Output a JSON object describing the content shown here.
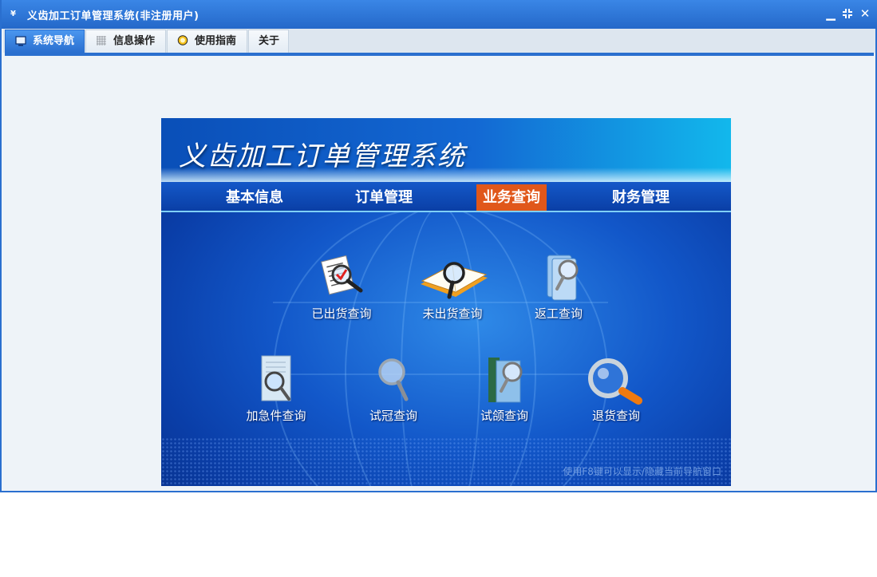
{
  "window": {
    "title": "义齿加工订单管理系统(非注册用户)",
    "app_icon": "app-logo-icon",
    "controls": {
      "minimize_icon": "minimize-icon",
      "restore_icon": "restore-icon",
      "close_icon": "close-icon"
    }
  },
  "tabs": [
    {
      "label": "系统导航",
      "icon": "monitor-icon",
      "active": true
    },
    {
      "label": "信息操作",
      "icon": "grid-icon",
      "active": false
    },
    {
      "label": "使用指南",
      "icon": "help-icon",
      "active": false
    },
    {
      "label": "关于",
      "icon": "",
      "active": false
    }
  ],
  "panel": {
    "system_title": "义齿加工订单管理系统",
    "nav": [
      {
        "label": "基本信息",
        "active": false
      },
      {
        "label": "订单管理",
        "active": false
      },
      {
        "label": "业务查询",
        "active": true
      },
      {
        "label": "财务管理",
        "active": false
      }
    ],
    "queries_row1": [
      {
        "label": "已出货查询",
        "icon": "document-magnifier-icon"
      },
      {
        "label": "未出货查询",
        "icon": "open-book-magnifier-icon"
      },
      {
        "label": "返工查询",
        "icon": "folder-magnifier-icon"
      }
    ],
    "queries_row2": [
      {
        "label": "加急件查询",
        "icon": "page-magnifier-icon"
      },
      {
        "label": "试冠查询",
        "icon": "magnifier-icon"
      },
      {
        "label": "试颌查询",
        "icon": "binder-magnifier-icon"
      },
      {
        "label": "退货查询",
        "icon": "large-magnifier-icon"
      }
    ],
    "hint": "使用F8键可以显示/隐藏当前导航窗口"
  },
  "colors": {
    "titlebar": "#2a6fcf",
    "active_nav": "#e0571a",
    "panel_dark": "#0a3ea8",
    "hint_text": "#6f9be0"
  }
}
